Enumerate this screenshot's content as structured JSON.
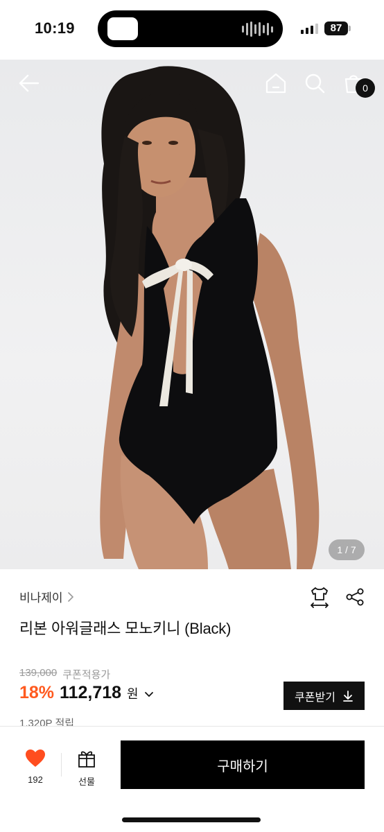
{
  "status_bar": {
    "time": "10:19",
    "battery": "87",
    "icons": [
      "cellular-signal-icon",
      "battery-icon"
    ]
  },
  "header": {
    "icons": [
      "back-arrow-icon",
      "home-icon",
      "search-icon",
      "shopping-bag-icon"
    ],
    "cart_count": "0"
  },
  "gallery": {
    "page_indicator": "1 / 7"
  },
  "product": {
    "brand": "비나제이",
    "title": "리본 아워글래스 모노키니 (Black)",
    "original_price": "139,000",
    "coupon_label": "쿠폰적용가",
    "discount": "18%",
    "sale_price": "112,718",
    "currency": "원",
    "points": "1,320P 적립",
    "coupon_button": "쿠폰받기",
    "icons": [
      "size-guide-icon",
      "share-icon",
      "chevron-right-icon",
      "chevron-down-icon",
      "download-icon"
    ]
  },
  "bottom_bar": {
    "like_count": "192",
    "gift_label": "선물",
    "buy_label": "구매하기",
    "icons": [
      "heart-icon",
      "gift-icon"
    ]
  },
  "colors": {
    "accent": "#ff5a1f",
    "primary": "#000000",
    "heart": "#ff4d1f"
  }
}
